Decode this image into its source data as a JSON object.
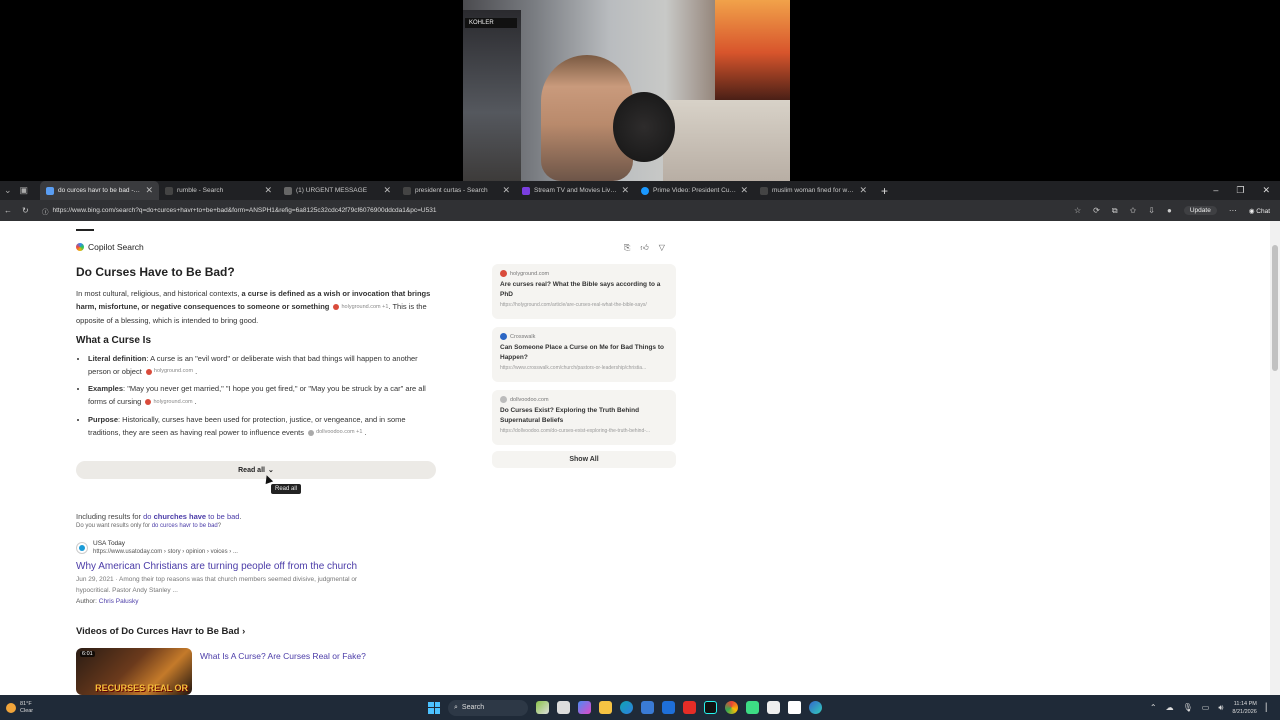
{
  "webcam": {
    "badge": "KOHLER"
  },
  "tabs": [
    {
      "title": "do curces havr to be bad - Search",
      "active": true
    },
    {
      "title": "rumble - Search",
      "active": false
    },
    {
      "title": "(1) URGENT MESSAGE",
      "active": false
    },
    {
      "title": "president curtas - Search",
      "active": false
    },
    {
      "title": "Stream TV and Movies Live and O",
      "active": false
    },
    {
      "title": "Prime Video: President Curtis, Se",
      "active": false
    },
    {
      "title": "muslim woman fined for wearing",
      "active": false
    }
  ],
  "address": {
    "url": "https://www.bing.com/search?q=do+curces+havr+to+be+bad&form=ANSPH1&refig=6a8125c32cdc42f79cf6076900ddcda1&pc=U531",
    "update_label": "Update",
    "chat_label": "Chat"
  },
  "copilot": {
    "label": "Copilot Search",
    "title": "Do Curses Have to Be Bad?",
    "intro_pre": "In most cultural, religious, and historical contexts, ",
    "intro_bold": "a curse is defined as a wish or invocation that brings harm, misfortune, or negative consequences to someone or something",
    "intro_cite": "holyground.com +1",
    "intro_post": ". This is the opposite of a blessing, which is intended to bring good.",
    "section_title": "What a Curse Is",
    "bullets": [
      {
        "term": "Literal definition",
        "text": ": A curse is an \"evil word\" or deliberate wish that bad things will happen to another person or object",
        "cite": "holyground.com"
      },
      {
        "term": "Examples",
        "text": ": \"May you never get married,\" \"I hope you get fired,\" or \"May you be struck by a car\" are all forms of cursing",
        "cite": "holyground.com"
      },
      {
        "term": "Purpose",
        "text": ": Historically, curses have been used for protection, justice, or vengeance, and in some traditions, they are seen as having real power to influence events",
        "cite": "dollvoodoo.com +1"
      }
    ],
    "read_all": "Read all",
    "tooltip": "Read all"
  },
  "sources": [
    {
      "site": "holyground.com",
      "title": "Are curses real? What the Bible says according to a PhD",
      "url": "https://holyground.com/article/are-curses-real-what-the-bible-says/"
    },
    {
      "site": "Crosswalk",
      "title": "Can Someone Place a Curse on Me for Bad Things to Happen?",
      "url": "https://www.crosswalk.com/church/pastors-or-leadership/christia..."
    },
    {
      "site": "dollvoodoo.com",
      "title": "Do Curses Exist? Exploring the Truth Behind Supernatural Beliefs",
      "url": "https://dollvoodoo.com/do-curses-exist-exploring-the-truth-behind-..."
    }
  ],
  "show_all": "Show All",
  "including": {
    "pre": "Including results for ",
    "q1": "do ",
    "q_bold": "churches have",
    "q2": " to be bad",
    "post": ".",
    "didyou_pre": "Do you want results only for ",
    "didyou_link": "do curces havr to be bad",
    "didyou_post": "?"
  },
  "result": {
    "site": "USA Today",
    "url": "https://www.usatoday.com › story › opinion › voices › ...",
    "title": "Why American Christians are turning people off from the church",
    "date": "Jun 29, 2021",
    "snippet": " · Among their top reasons was that church members seemed divisive, judgmental or hypocritical. Pastor Andy Stanley ...",
    "author_label": "Author: ",
    "author": "Chris Palusky"
  },
  "videos": {
    "heading": "Videos of Do Curces Havr to Be Bad ›",
    "items": [
      {
        "duration": "6:01",
        "thumb_text": "RECURSES REAL OR",
        "title": "What Is A Curse? Are Curses Real or Fake?"
      }
    ]
  },
  "taskbar": {
    "temp": "81°F",
    "cond": "Clear",
    "search": "Search",
    "time": "11:14 PM",
    "date": "8/21/2026"
  }
}
